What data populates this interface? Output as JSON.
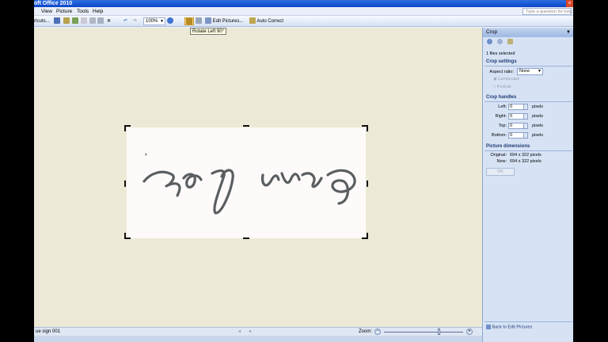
{
  "window": {
    "title": "oft Office 2010"
  },
  "menu": {
    "items": [
      "View",
      "Picture",
      "Tools",
      "Help"
    ],
    "help_placeholder": "Type a question for help"
  },
  "toolbar": {
    "shortcuts_label": "rtcuts...",
    "zoom_value": "100%",
    "edit_pictures_label": "Edit Pictures...",
    "auto_correct_label": "Auto Correct"
  },
  "tooltip": "Rotate Left 90°",
  "status": {
    "filename": "ue sign 001",
    "zoom_label": "Zoom:",
    "zoom_level": 0.7
  },
  "pane": {
    "title": "Crop",
    "files_selected": "1 files selected",
    "crop_settings": {
      "heading": "Crop settings",
      "aspect_label": "Aspect ratio:",
      "aspect_value": "None",
      "landscape": "Landscape",
      "portrait": "Portrait"
    },
    "crop_handles": {
      "heading": "Crop handles",
      "rows": [
        {
          "label": "Left:",
          "value": "0",
          "unit": "pixels"
        },
        {
          "label": "Right:",
          "value": "0",
          "unit": "pixels"
        },
        {
          "label": "Top:",
          "value": "0",
          "unit": "pixels"
        },
        {
          "label": "Bottom:",
          "value": "0",
          "unit": "pixels"
        }
      ]
    },
    "dimensions": {
      "heading": "Picture dimensions",
      "original_label": "Original:",
      "original_value": "694 x 322 pixels",
      "new_label": "New:",
      "new_value": "694 x 322 pixels"
    },
    "ok_label": "OK",
    "back_label": "Back to Edit Pictures"
  }
}
